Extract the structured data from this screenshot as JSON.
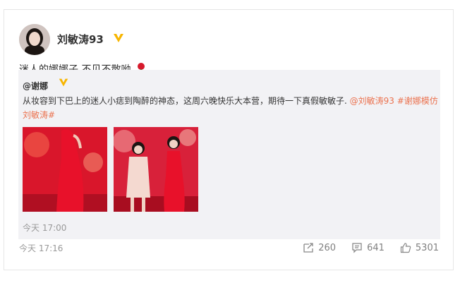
{
  "post": {
    "username": "刘敏涛93",
    "text": "迷人的娜娜子 不见不散呦",
    "time": "今天 17:16",
    "stats": {
      "reposts": "260",
      "comments": "641",
      "likes": "5301"
    }
  },
  "repost": {
    "username": "@谢娜",
    "text_main": "从妆容到下巴上的迷人小痣到陶醉的神态，这周六晚快乐大本营，期待一下真假敏敏子. ",
    "mention": "@刘敏涛93",
    "hashtag": "#谢娜模仿刘敏涛#",
    "time": "今天 17:00"
  },
  "colors": {
    "accent": "#eb7350",
    "verified": "#f7b500",
    "stage_red": "#d9162b"
  },
  "icons": [
    "verified-icon",
    "rose-icon",
    "repost-icon",
    "comment-icon",
    "like-icon"
  ]
}
